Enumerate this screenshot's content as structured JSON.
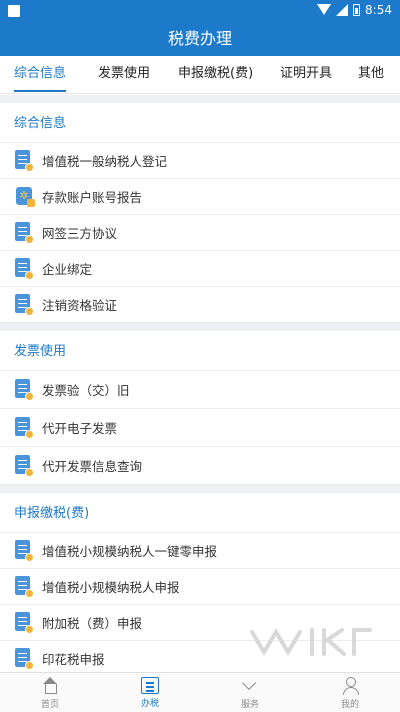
{
  "status_bar": {
    "time": "8:54"
  },
  "app_bar": {
    "title": "税费办理"
  },
  "tabs": [
    {
      "label": "综合信息",
      "active": true
    },
    {
      "label": "发票使用",
      "active": false
    },
    {
      "label": "申报缴税(费)",
      "active": false
    },
    {
      "label": "证明开具",
      "active": false
    },
    {
      "label": "其他",
      "active": false
    }
  ],
  "sections": [
    {
      "title": "综合信息",
      "items": [
        {
          "label": "增值税一般纳税人登记",
          "icon": "document-icon"
        },
        {
          "label": "存款账户账号报告",
          "icon": "settings-doc-icon"
        },
        {
          "label": "网签三方协议",
          "icon": "document-icon"
        },
        {
          "label": "企业绑定",
          "icon": "document-icon"
        },
        {
          "label": "注销资格验证",
          "icon": "document-icon"
        }
      ]
    },
    {
      "title": "发票使用",
      "items": [
        {
          "label": "发票验（交）旧",
          "icon": "document-icon"
        },
        {
          "label": "代开电子发票",
          "icon": "document-icon"
        },
        {
          "label": "代开发票信息查询",
          "icon": "document-icon"
        }
      ]
    },
    {
      "title": "申报缴税(费)",
      "items": [
        {
          "label": "增值税小规模纳税人一键零申报",
          "icon": "document-icon"
        },
        {
          "label": "增值税小规模纳税人申报",
          "icon": "document-icon"
        },
        {
          "label": "附加税（费）申报",
          "icon": "document-icon"
        },
        {
          "label": "印花税申报",
          "icon": "document-icon"
        }
      ]
    }
  ],
  "bottom_nav": [
    {
      "label": "首页",
      "icon": "home-icon",
      "active": false
    },
    {
      "label": "办税",
      "icon": "list-icon",
      "active": true
    },
    {
      "label": "服务",
      "icon": "heart-icon",
      "active": false
    },
    {
      "label": "我的",
      "icon": "user-icon",
      "active": false
    }
  ],
  "colors": {
    "primary": "#1d79c9",
    "accent": "#f2b33a",
    "divider": "#ececec",
    "section_gap": "#eef0f3"
  }
}
